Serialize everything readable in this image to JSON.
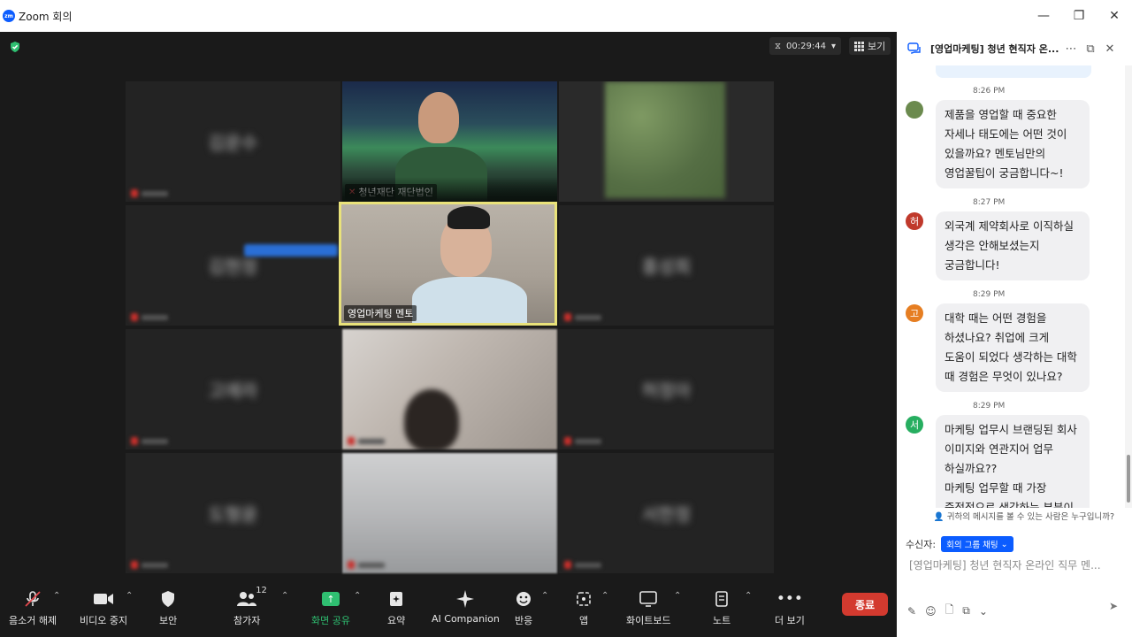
{
  "window": {
    "app_title": "Zoom 회의",
    "logo_text": "zm",
    "controls": [
      "—",
      "❐",
      "✕"
    ]
  },
  "meeting": {
    "timer": "00:29:44",
    "view_label": "보기",
    "tiles": {
      "host": "청년재단 재단법인",
      "mentor": "영업마케팅 멘토",
      "blurred_names": [
        "김운수",
        "김현정",
        "홍성희",
        "고예라",
        "허정아",
        "도형윤",
        "서한정"
      ]
    }
  },
  "toolbar": {
    "mute": "음소거 해제",
    "video": "비디오 중지",
    "security": "보안",
    "participants": "참가자",
    "participants_count": "12",
    "share": "화면 공유",
    "summary": "요약",
    "ai": "AI Companion",
    "reactions": "반응",
    "apps": "앱",
    "whiteboard": "화이트보드",
    "notes": "노트",
    "more": "더 보기",
    "end": "종료"
  },
  "chat": {
    "title": "[영업마케팅] 청년 현직자 온...",
    "messages": [
      {
        "time": "8:26 PM",
        "avatar_text": "",
        "avatar_color": "#6b8a4e",
        "text": "제품을 영업할 때 중요한 자세나 태도에는 어떤 것이 있을까요? 멘토님만의 영업꿀팁이 궁금합니다~!"
      },
      {
        "time": "8:27 PM",
        "avatar_text": "허",
        "avatar_color": "#c0392b",
        "text": "외국계 제약회사로 이직하실 생각은 안해보셨는지 궁금합니다!"
      },
      {
        "time": "8:29 PM",
        "avatar_text": "고",
        "avatar_color": "#e67e22",
        "text": "대학 때는 어떤 경험을 하셨나요? 취업에 크게 도움이 되었다 생각하는 대학 때 경험은 무엇이 있나요?"
      },
      {
        "time": "8:29 PM",
        "avatar_text": "서",
        "avatar_color": "#27ae60",
        "text": "마케팅 업무시 브랜딩된 회사 이미지와 연관지어 업무 하실까요??\n마케팅 업무할 때 가장 중점적으로 생각하는 부분이 있으신"
      }
    ],
    "privacy_note": "귀하의 메시지를 볼 수 있는 사람은 누구입니까?",
    "recipient_label": "수신자:",
    "recipient_value": "회의 그룹 채팅",
    "input_placeholder": "[영업마케팅] 청년 현직자 온라인 직무 멘..."
  }
}
